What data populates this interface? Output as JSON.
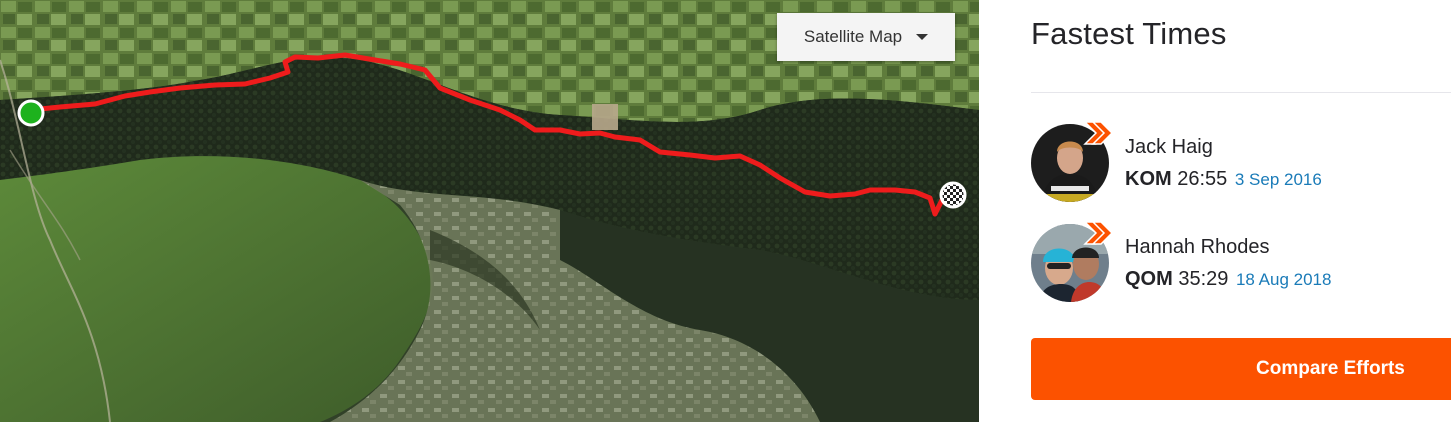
{
  "map": {
    "type_selector": {
      "label": "Satellite Map",
      "icon": "caret-down-icon"
    },
    "route_color": "#ee1c1c",
    "start_marker_color": "#1db21d",
    "end_marker": "checkered-flag-icon"
  },
  "leaderboard": {
    "title": "Fastest Times",
    "entries": [
      {
        "name": "Jack Haig",
        "tag": "KOM",
        "time": "26:55",
        "date": "3 Sep 2016",
        "badge_color": "#fc5200"
      },
      {
        "name": "Hannah Rhodes",
        "tag": "QOM",
        "time": "35:29",
        "date": "18 Aug 2018",
        "badge_color": "#fc5200"
      }
    ],
    "compare_button": "Compare Efforts"
  }
}
